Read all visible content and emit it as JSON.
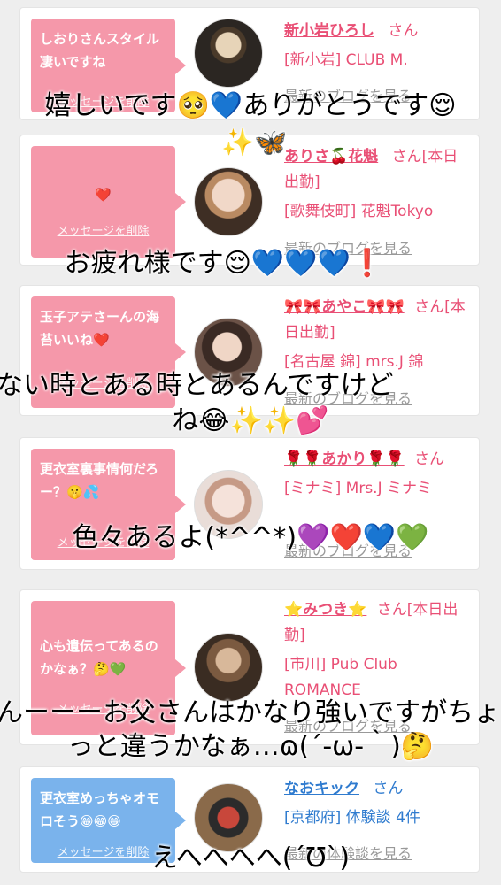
{
  "delete_label": "メッセージを削除",
  "card1": {
    "message": "しおりさんスタイル凄いですね",
    "name": "新小岩ひろし",
    "san": "さん",
    "shop": "[新小岩] CLUB M.",
    "link": "最新のブログを見る",
    "caption": "嬉しいです🥺💙ありがとうです😌"
  },
  "card2": {
    "message": "❤️",
    "name": "ありさ🍒花魁",
    "san": "さん[本日出勤]",
    "shop": "[歌舞伎町] 花魁Tokyo",
    "link": "最新のブログを見る",
    "caption_top": "✨🦋",
    "caption": "お疲れ様です😌💙💙💙❗"
  },
  "card3": {
    "message": "玉子アテさーんの海苔いいね❤️",
    "name": "🎀🎀あやこ🎀🎀",
    "san": "さん[本日出勤]",
    "shop": "[名古屋 錦] mrs.J 錦",
    "link": "最新のブログを見る",
    "caption_line1": "ない時とある時とあるんですけど",
    "caption_line2": "ね😂✨✨💕"
  },
  "card4": {
    "message": "更衣室裏事情何だろー？🤫💦",
    "name": "🌹🌹あかり🌹🌹",
    "san": "さん",
    "shop": "[ミナミ] Mrs.J ミナミ",
    "link": "最新のブログを見る",
    "caption": "色々あるよ(*^^*)💜❤️💙💚"
  },
  "card5": {
    "message": "心も遺伝ってあるのかなぁ？🤔💚",
    "name": "⭐みつき⭐",
    "san": "さん[本日出勤]",
    "shop": "[市川] Pub Club ROMANCE",
    "link": "最新のブログを見る",
    "caption_line1": "んーーーお父さんはかなり強いですがちょ",
    "caption_line2": "っと違うかなぁ…ɷ(´-ω-｀)🤔"
  },
  "card6": {
    "message": "更衣室めっちゃオモロそう😁😁😁",
    "name": "なおキック",
    "san": "さん",
    "shop": "[京都府] 体験談 4件",
    "link": "最新の体験談を見る",
    "caption": "えへへへへ(´Ʊ`)"
  },
  "colors": {
    "bubble_pink": "#f598aa",
    "bubble_blue": "#7ab3ec",
    "name_pink": "#e94f75",
    "name_blue": "#2f7bcf",
    "link_gray": "#999999"
  }
}
